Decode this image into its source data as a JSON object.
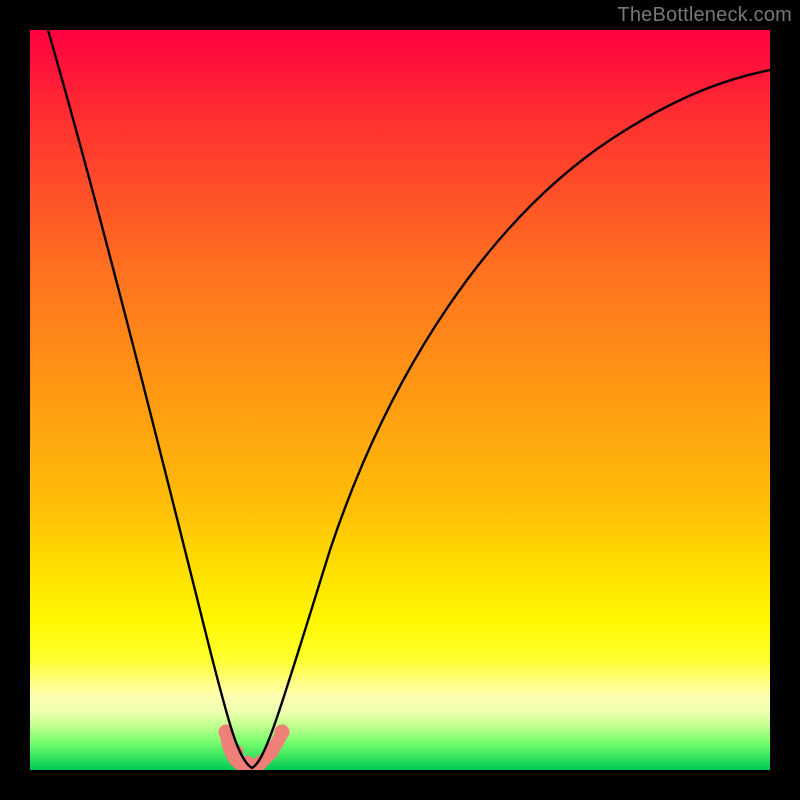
{
  "watermark": "TheBottleneck.com",
  "chart_data": {
    "type": "line",
    "title": "",
    "xlabel": "",
    "ylabel": "",
    "xlim": [
      0,
      100
    ],
    "ylim": [
      0,
      100
    ],
    "grid": false,
    "legend": false,
    "series": [
      {
        "name": "curve",
        "color": "#000000",
        "x": [
          0,
          4,
          8,
          12,
          16,
          20,
          24,
          26,
          28,
          29,
          30,
          31,
          32,
          33,
          34,
          36,
          40,
          46,
          52,
          60,
          70,
          80,
          90,
          100
        ],
        "y": [
          100,
          86,
          72,
          58,
          45,
          32,
          18,
          10,
          4,
          1.5,
          0.5,
          0.5,
          1.5,
          4,
          8,
          16,
          30,
          46,
          58,
          70,
          80,
          86,
          90,
          93
        ]
      },
      {
        "name": "bottom-markers",
        "color": "#f08078",
        "marker_only": true,
        "x": [
          26.5,
          28,
          29.5,
          31,
          32.5,
          34
        ],
        "y": [
          5.0,
          2.0,
          0.8,
          0.8,
          2.0,
          5.0
        ]
      }
    ],
    "colors": {
      "gradient_top": "#ff0040",
      "gradient_mid": "#ffe000",
      "gradient_bottom": "#00c858",
      "frame": "#000000",
      "watermark": "#777777"
    }
  }
}
